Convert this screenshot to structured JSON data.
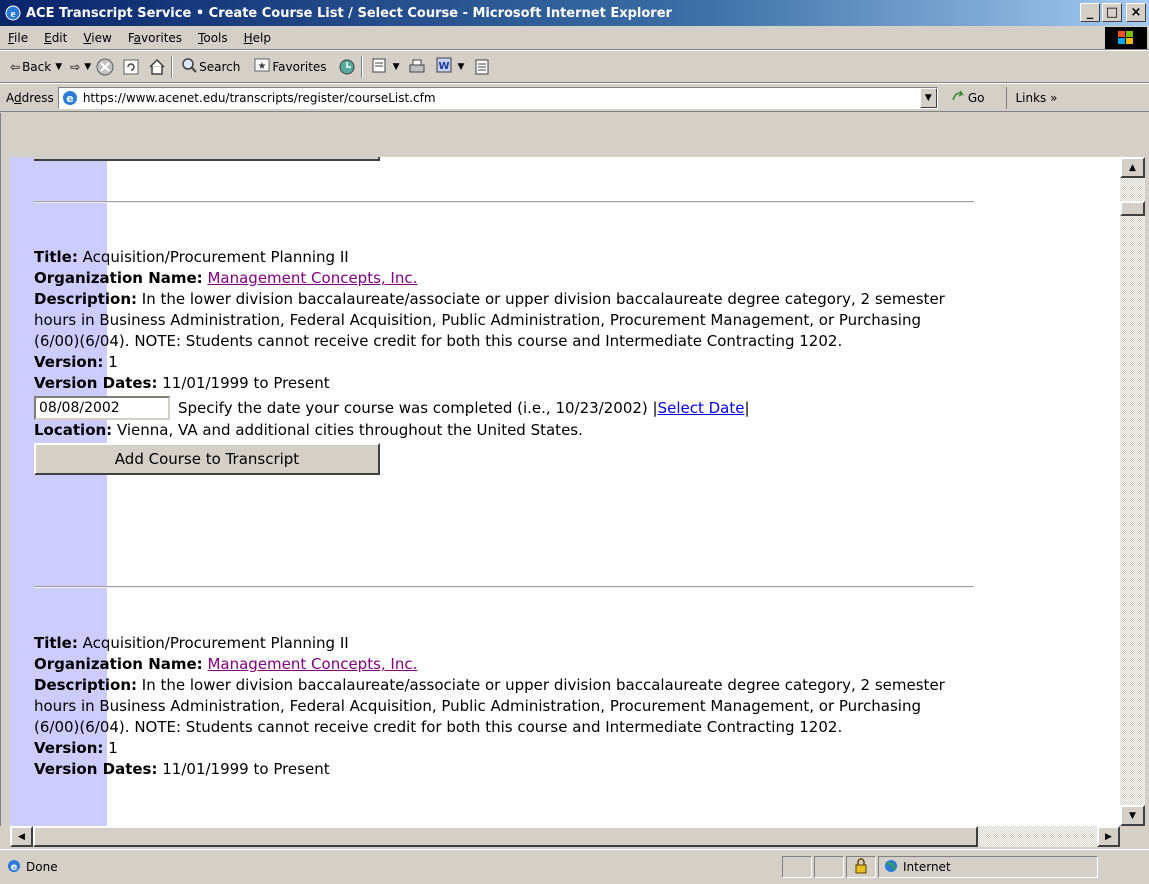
{
  "window": {
    "title": "ACE Transcript Service • Create Course List / Select Course - Microsoft Internet Explorer",
    "minimize": "_",
    "maximize": "□",
    "close": "×"
  },
  "menu": {
    "items": [
      {
        "underline": "F",
        "rest": "ile"
      },
      {
        "underline": "E",
        "rest": "dit"
      },
      {
        "underline": "V",
        "rest": "iew"
      },
      {
        "pre": "F",
        "underline": "a",
        "rest": "vorites"
      },
      {
        "underline": "T",
        "rest": "ools"
      },
      {
        "underline": "H",
        "rest": "elp"
      }
    ]
  },
  "toolbar": {
    "back_label": "Back",
    "search_label": "Search",
    "favorites_label": "Favorites"
  },
  "address": {
    "label_pre": "A",
    "label_u": "d",
    "label_rest": "dress",
    "url": "https://www.acenet.edu/transcripts/register/courseList.cfm",
    "go_label": "Go",
    "links_label": "Links »"
  },
  "records": [
    {
      "title_label": "Title:",
      "title": "Acquisition/Procurement Planning II",
      "org_label": "Organization Name:",
      "org": "Management Concepts, Inc.",
      "desc_label": "Description:",
      "desc": "In the lower division baccalaureate/associate or upper division baccalaureate degree category, 2 semester hours in Business Administration, Federal Acquisition, Public Administration, Procurement Management, or Purchasing (6/00)(6/04). NOTE: Students cannot receive credit for both this course and Intermediate Contracting 1202.",
      "version_label": "Version:",
      "version": "1",
      "dates_label": "Version Dates:",
      "dates": "11/01/1999 to Present",
      "date_value": "08/08/2002",
      "date_hint": "Specify the date your course was completed (i.e., 10/23/2002) |",
      "select_date": "Select Date",
      "date_hint_end": "|",
      "location_label": "Location:",
      "location": "Vienna, VA and additional cities throughout the United States.",
      "add_button": "Add Course to Transcript"
    },
    {
      "title_label": "Title:",
      "title": "Acquisition/Procurement Planning II",
      "org_label": "Organization Name:",
      "org": "Management Concepts, Inc.",
      "desc_label": "Description:",
      "desc": "In the lower division baccalaureate/associate or upper division baccalaureate degree category, 2 semester hours in Business Administration, Federal Acquisition, Public Administration, Procurement Management, or Purchasing (6/00)(6/04). NOTE: Students cannot receive credit for both this course and Intermediate Contracting 1202.",
      "version_label": "Version:",
      "version": "1",
      "dates_label": "Version Dates:",
      "dates": "11/01/1999 to Present"
    }
  ],
  "status": {
    "text": "Done",
    "zone": "Internet"
  }
}
